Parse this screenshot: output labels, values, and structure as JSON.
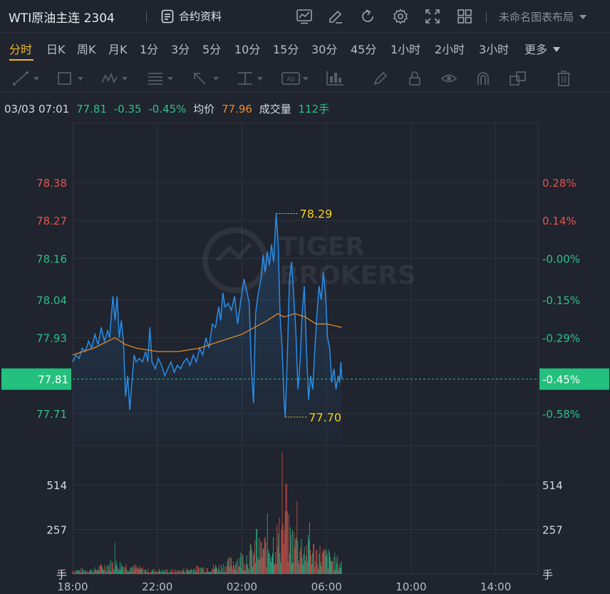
{
  "header": {
    "symbol": "WTI原油主连 2304",
    "contract_info_label": "合约资料",
    "layout_name": "未命名图表布局",
    "icons": [
      "doc-icon",
      "line-chart-icon",
      "edit-icon",
      "refresh-icon",
      "gear-icon",
      "fullscreen-icon",
      "grid-icon",
      "caret-down-icon"
    ]
  },
  "periods": [
    {
      "label": "分时",
      "active": true
    },
    {
      "label": "日K"
    },
    {
      "label": "周K"
    },
    {
      "label": "月K"
    },
    {
      "label": "1分"
    },
    {
      "label": "3分"
    },
    {
      "label": "5分"
    },
    {
      "label": "10分"
    },
    {
      "label": "15分"
    },
    {
      "label": "30分"
    },
    {
      "label": "45分"
    },
    {
      "label": "1小时"
    },
    {
      "label": "2小时"
    },
    {
      "label": "3小时"
    },
    {
      "label": "更多",
      "dropdown": true
    }
  ],
  "toolbar_tools": [
    "trend-line-icon",
    "rectangle-icon",
    "pattern-icon",
    "fibonacci-icon",
    "arrow-icon",
    "price-range-icon",
    "text-note-icon",
    "measure-icon",
    "brush-icon",
    "lock-icon",
    "eye-icon",
    "magnet-icon",
    "layers-icon",
    "trash-icon"
  ],
  "quote": {
    "time": "03/03 07:01",
    "price": "77.81",
    "change": "-0.35",
    "change_pct": "-0.45%",
    "avg_label": "均价",
    "avg_price": "77.96",
    "volume_label": "成交量",
    "volume": "112手"
  },
  "colors": {
    "background": "#1f242e",
    "price_line": "#2a8ce8",
    "avg_line": "#e08a2c",
    "up": "#e5534b",
    "down": "#2fbf8b",
    "marker": "#f5d020",
    "current_price_bg": "#24c07e",
    "active_tab": "#f5b721"
  },
  "watermark": {
    "line1": "TIGER",
    "line2": "BROKERS"
  },
  "chart_data": [
    {
      "type": "line",
      "name": "price-chart",
      "x_ticks": [
        "18:00",
        "22:00",
        "02:00",
        "06:00",
        "10:00",
        "14:00"
      ],
      "x_range_hours": [
        0,
        22
      ],
      "y_ticks_left": [
        {
          "value": 78.38,
          "label": "78.38",
          "side": "up"
        },
        {
          "value": 78.27,
          "label": "78.27",
          "side": "up"
        },
        {
          "value": 78.16,
          "label": "78.16",
          "side": "down"
        },
        {
          "value": 78.04,
          "label": "78.04",
          "side": "down"
        },
        {
          "value": 77.93,
          "label": "77.93",
          "side": "down"
        },
        {
          "value": 77.71,
          "label": "77.71",
          "side": "down"
        }
      ],
      "y_ticks_right": [
        {
          "value": 78.38,
          "label": "0.28%",
          "side": "up"
        },
        {
          "value": 78.27,
          "label": "0.14%",
          "side": "up"
        },
        {
          "value": 78.16,
          "label": "-0.00%",
          "side": "down"
        },
        {
          "value": 78.04,
          "label": "-0.15%",
          "side": "down"
        },
        {
          "value": 77.93,
          "label": "-0.29%",
          "side": "down"
        },
        {
          "value": 77.71,
          "label": "-0.58%",
          "side": "down"
        }
      ],
      "current_price": {
        "value": 77.81,
        "label_left": "77.81",
        "label_right": "-0.45%"
      },
      "high_marker": {
        "t": 9.62,
        "value": 78.29,
        "label": "78.29"
      },
      "low_marker": {
        "t": 10.05,
        "value": 77.7,
        "label": "77.70"
      },
      "price_series": [
        [
          0.0,
          77.86
        ],
        [
          0.15,
          77.88
        ],
        [
          0.3,
          77.87
        ],
        [
          0.45,
          77.9
        ],
        [
          0.6,
          77.89
        ],
        [
          0.75,
          77.92
        ],
        [
          0.9,
          77.9
        ],
        [
          1.05,
          77.94
        ],
        [
          1.2,
          77.91
        ],
        [
          1.35,
          77.96
        ],
        [
          1.5,
          77.92
        ],
        [
          1.65,
          77.95
        ],
        [
          1.75,
          77.93
        ],
        [
          1.9,
          78.05
        ],
        [
          2.0,
          77.98
        ],
        [
          2.1,
          78.05
        ],
        [
          2.2,
          77.93
        ],
        [
          2.3,
          77.98
        ],
        [
          2.4,
          77.92
        ],
        [
          2.5,
          77.76
        ],
        [
          2.6,
          77.82
        ],
        [
          2.7,
          77.72
        ],
        [
          2.8,
          77.8
        ],
        [
          2.9,
          77.88
        ],
        [
          3.0,
          77.86
        ],
        [
          3.15,
          77.87
        ],
        [
          3.3,
          77.86
        ],
        [
          3.45,
          77.89
        ],
        [
          3.55,
          77.86
        ],
        [
          3.65,
          77.96
        ],
        [
          3.75,
          77.86
        ],
        [
          3.9,
          77.84
        ],
        [
          4.05,
          77.87
        ],
        [
          4.2,
          77.85
        ],
        [
          4.35,
          77.82
        ],
        [
          4.5,
          77.84
        ],
        [
          4.65,
          77.86
        ],
        [
          4.8,
          77.83
        ],
        [
          4.95,
          77.85
        ],
        [
          5.1,
          77.84
        ],
        [
          5.25,
          77.86
        ],
        [
          5.4,
          77.87
        ],
        [
          5.55,
          77.85
        ],
        [
          5.7,
          77.88
        ],
        [
          5.85,
          77.86
        ],
        [
          6.0,
          77.9
        ],
        [
          6.15,
          77.88
        ],
        [
          6.3,
          77.93
        ],
        [
          6.45,
          77.9
        ],
        [
          6.6,
          77.97
        ],
        [
          6.75,
          77.96
        ],
        [
          6.9,
          78.02
        ],
        [
          7.0,
          77.98
        ],
        [
          7.1,
          78.06
        ],
        [
          7.2,
          78.02
        ],
        [
          7.35,
          78.03
        ],
        [
          7.5,
          78.01
        ],
        [
          7.65,
          78.05
        ],
        [
          7.8,
          77.97
        ],
        [
          7.95,
          78.04
        ],
        [
          8.1,
          78.1
        ],
        [
          8.25,
          78.06
        ],
        [
          8.35,
          78.03
        ],
        [
          8.45,
          77.84
        ],
        [
          8.55,
          77.74
        ],
        [
          8.65,
          78.0
        ],
        [
          8.75,
          78.05
        ],
        [
          8.9,
          78.1
        ],
        [
          9.0,
          78.17
        ],
        [
          9.1,
          78.12
        ],
        [
          9.2,
          78.18
        ],
        [
          9.3,
          78.14
        ],
        [
          9.4,
          78.2
        ],
        [
          9.5,
          78.15
        ],
        [
          9.62,
          78.29
        ],
        [
          9.72,
          78.2
        ],
        [
          9.8,
          78.0
        ],
        [
          9.9,
          77.9
        ],
        [
          10.0,
          77.74
        ],
        [
          10.05,
          77.7
        ],
        [
          10.15,
          77.88
        ],
        [
          10.25,
          78.1
        ],
        [
          10.35,
          78.15
        ],
        [
          10.45,
          78.05
        ],
        [
          10.55,
          77.95
        ],
        [
          10.65,
          77.78
        ],
        [
          10.75,
          77.86
        ],
        [
          10.85,
          78.0
        ],
        [
          10.95,
          78.08
        ],
        [
          11.05,
          77.9
        ],
        [
          11.15,
          77.75
        ],
        [
          11.25,
          77.82
        ],
        [
          11.35,
          77.78
        ],
        [
          11.45,
          77.9
        ],
        [
          11.55,
          78.0
        ],
        [
          11.65,
          78.08
        ],
        [
          11.75,
          78.04
        ],
        [
          11.85,
          78.12
        ],
        [
          11.95,
          78.06
        ],
        [
          12.05,
          77.93
        ],
        [
          12.15,
          77.9
        ],
        [
          12.25,
          77.8
        ],
        [
          12.35,
          77.84
        ],
        [
          12.45,
          77.78
        ],
        [
          12.55,
          77.82
        ],
        [
          12.62,
          77.8
        ],
        [
          12.68,
          77.86
        ],
        [
          12.72,
          77.81
        ]
      ],
      "avg_series": [
        [
          0.0,
          77.88
        ],
        [
          1.0,
          77.9
        ],
        [
          2.0,
          77.93
        ],
        [
          2.5,
          77.91
        ],
        [
          3.0,
          77.9
        ],
        [
          4.0,
          77.89
        ],
        [
          5.0,
          77.89
        ],
        [
          6.0,
          77.9
        ],
        [
          7.0,
          77.92
        ],
        [
          8.0,
          77.94
        ],
        [
          8.6,
          77.96
        ],
        [
          9.2,
          77.98
        ],
        [
          9.7,
          78.0
        ],
        [
          10.0,
          77.99
        ],
        [
          10.5,
          78.0
        ],
        [
          11.0,
          77.99
        ],
        [
          11.5,
          77.97
        ],
        [
          12.0,
          77.97
        ],
        [
          12.72,
          77.96
        ]
      ]
    },
    {
      "type": "bar",
      "name": "volume-chart",
      "y_ticks": [
        {
          "value": 514,
          "label": "514"
        },
        {
          "value": 257,
          "label": "257"
        }
      ],
      "unit": "手",
      "ylim": [
        0,
        720
      ],
      "volume_profile": [
        [
          0.0,
          25
        ],
        [
          1.0,
          28
        ],
        [
          1.8,
          70
        ],
        [
          2.5,
          60
        ],
        [
          3.5,
          25
        ],
        [
          5.0,
          22
        ],
        [
          6.0,
          40
        ],
        [
          7.0,
          50
        ],
        [
          8.0,
          110
        ],
        [
          8.8,
          160
        ],
        [
          9.5,
          220
        ],
        [
          10.0,
          300
        ],
        [
          10.5,
          210
        ],
        [
          11.0,
          180
        ],
        [
          11.5,
          150
        ],
        [
          12.0,
          120
        ],
        [
          12.72,
          70
        ]
      ],
      "volume_spikes": [
        [
          9.9,
          700
        ],
        [
          10.1,
          520
        ],
        [
          9.2,
          350
        ],
        [
          10.6,
          420
        ],
        [
          8.7,
          260
        ],
        [
          2.0,
          180
        ],
        [
          11.2,
          300
        ]
      ]
    }
  ]
}
